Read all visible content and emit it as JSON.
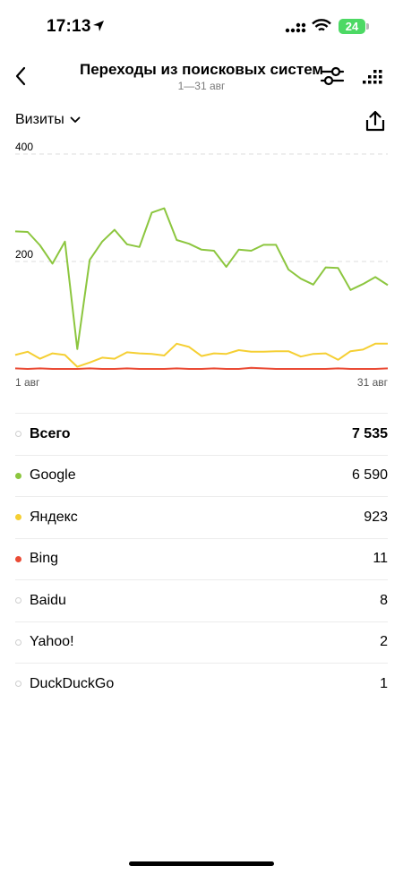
{
  "status": {
    "time": "17:13",
    "battery": "24"
  },
  "header": {
    "title": "Переходы из поисковых систем",
    "subtitle": "1—31 авг"
  },
  "metric": {
    "label": "Визиты"
  },
  "colors": {
    "google": "#8cc63f",
    "yandex": "#f5cf33",
    "bing": "#ea4b35",
    "gridline": "#dcdcdc"
  },
  "icons": {
    "back": "chevron-left-icon",
    "filter": "sliders-icon",
    "grid": "dot-grid-icon",
    "metric_dropdown": "chevron-down-icon",
    "share": "share-icon"
  },
  "chart_data": {
    "type": "line",
    "x": [
      "1 авг",
      "2 авг",
      "3 авг",
      "4 авг",
      "5 авг",
      "6 авг",
      "7 авг",
      "8 авг",
      "9 авг",
      "10 авг",
      "11 авг",
      "12 авг",
      "13 авг",
      "14 авг",
      "15 авг",
      "16 авг",
      "17 авг",
      "18 авг",
      "19 авг",
      "20 авг",
      "21 авг",
      "22 авг",
      "23 авг",
      "24 авг",
      "25 авг",
      "26 авг",
      "27 авг",
      "28 авг",
      "29 авг",
      "30 авг",
      "31 авг"
    ],
    "tick_labels": [
      "1 авг",
      "31 авг"
    ],
    "y_tick_labels": [
      "400",
      "200"
    ],
    "ylim": [
      0,
      400
    ],
    "grid": true,
    "series": [
      {
        "name": "Google",
        "color": "#8cc63f",
        "values": [
          256,
          255,
          230,
          196,
          237,
          37,
          203,
          237,
          259,
          232,
          227,
          291,
          299,
          240,
          233,
          222,
          220,
          190,
          222,
          220,
          231,
          231,
          185,
          168,
          157,
          189,
          188,
          147,
          158,
          171,
          156
        ]
      },
      {
        "name": "Яндекс",
        "color": "#f5cf33",
        "values": [
          26,
          32,
          19,
          29,
          26,
          4,
          12,
          21,
          19,
          31,
          29,
          28,
          25,
          47,
          41,
          24,
          29,
          28,
          35,
          32,
          32,
          33,
          33,
          23,
          28,
          29,
          17,
          33,
          36,
          47,
          47
        ]
      },
      {
        "name": "Bing",
        "color": "#ea4b35",
        "values": [
          1,
          0,
          1,
          0,
          0,
          0,
          1,
          0,
          0,
          1,
          0,
          0,
          0,
          1,
          0,
          0,
          1,
          0,
          0,
          2,
          1,
          0,
          0,
          0,
          0,
          0,
          1,
          0,
          0,
          0,
          1
        ]
      }
    ]
  },
  "legend": [
    {
      "label": "Всего",
      "value": "7 535",
      "color": "",
      "total": true
    },
    {
      "label": "Google",
      "value": "6 590",
      "color": "#8cc63f",
      "total": false
    },
    {
      "label": "Яндекс",
      "value": "923",
      "color": "#f5cf33",
      "total": false
    },
    {
      "label": "Bing",
      "value": "11",
      "color": "#ea4b35",
      "total": false
    },
    {
      "label": "Baidu",
      "value": "8",
      "color": "",
      "total": false
    },
    {
      "label": "Yahoo!",
      "value": "2",
      "color": "",
      "total": false
    },
    {
      "label": "DuckDuckGo",
      "value": "1",
      "color": "",
      "total": false
    }
  ]
}
